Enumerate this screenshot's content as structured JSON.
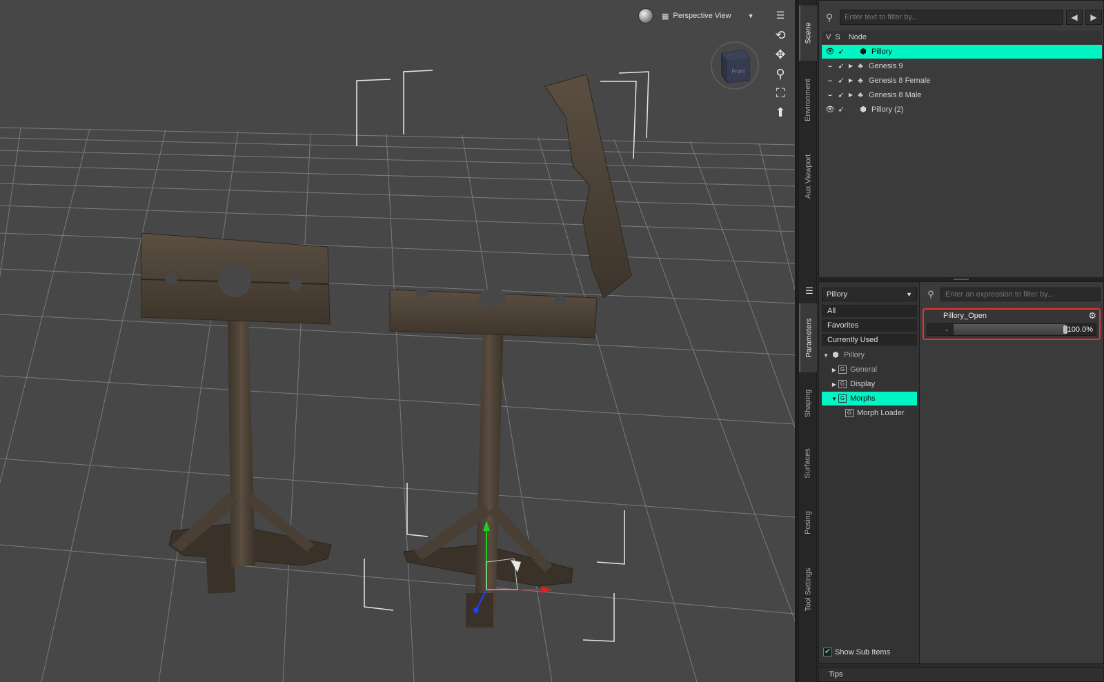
{
  "viewport": {
    "view_label": "Perspective View",
    "cube_face": "Front"
  },
  "side_tabs": {
    "scene": "Scene",
    "environment": "Environment",
    "aux_viewport": "Aux Viewport",
    "parameters": "Parameters",
    "shaping": "Shaping",
    "surfaces": "Surfaces",
    "posing": "Posing",
    "tool_settings": "Tool Settings"
  },
  "scene_pane": {
    "filter_placeholder": "Enter text to filter by...",
    "col_v": "V",
    "col_s": "S",
    "col_node": "Node",
    "nodes": [
      {
        "name": "Pillory",
        "selected": true
      },
      {
        "name": "Genesis 9",
        "selected": false
      },
      {
        "name": "Genesis 8 Female",
        "selected": false
      },
      {
        "name": "Genesis 8 Male",
        "selected": false
      },
      {
        "name": "Pillory (2)",
        "selected": false
      }
    ]
  },
  "params_pane": {
    "node_select": "Pillory",
    "expr_placeholder": "Enter an expression to filter by...",
    "categories": [
      "All",
      "Favorites",
      "Currently Used"
    ],
    "tree": {
      "root": "Pillory",
      "general": "General",
      "display": "Display",
      "morphs": "Morphs",
      "morph_loader": "Morph Loader"
    },
    "show_sub_items": "Show Sub Items",
    "slider": {
      "label": "Pillory_Open",
      "minus": "-",
      "value_text": "100.0%",
      "value": 1.0
    }
  },
  "tips": "Tips",
  "colors": {
    "selection": "#00f5c4",
    "highlight_box": "#e5332a"
  }
}
